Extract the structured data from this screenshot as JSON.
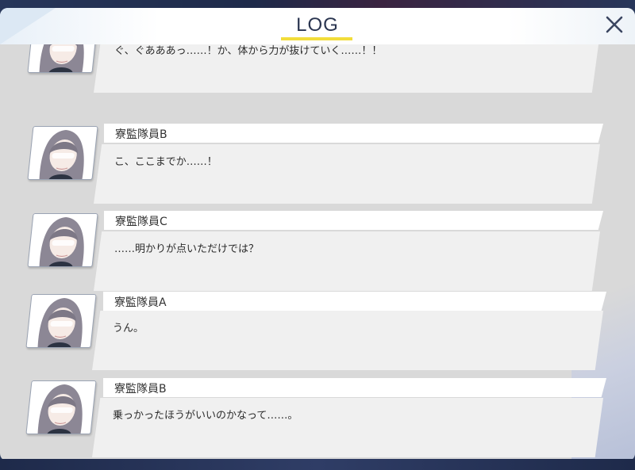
{
  "header": {
    "title": "LOG",
    "close_icon": "close-icon"
  },
  "colors": {
    "accent": "#f2dd3a",
    "panel": "#d9d9d9",
    "bubble": "#f0f0f0",
    "title": "#2a3550"
  },
  "entries": [
    {
      "speaker": "",
      "message": "ぐ、ぐあああっ……！か、体から力が抜けていく……！！"
    },
    {
      "speaker": "寮監隊員B",
      "message": "こ、ここまでか……！"
    },
    {
      "speaker": "寮監隊員C",
      "message": "……明かりが点いただけでは？"
    },
    {
      "speaker": "寮監隊員A",
      "message": "うん。"
    },
    {
      "speaker": "寮監隊員B",
      "message": "乗っかったほうがいいのかなって……。"
    }
  ]
}
